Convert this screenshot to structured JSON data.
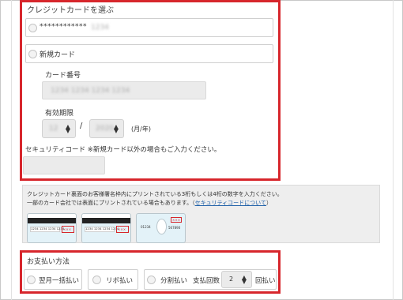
{
  "card_select": {
    "title": "クレジットカードを選ぶ",
    "saved_card_mask": "************",
    "saved_card_suffix": "1234",
    "new_card_label": "新規カード",
    "card_number_label": "カード番号",
    "card_number_value": "1234 1234 1234 1234",
    "expiry_label": "有効期限",
    "expiry_month": "12",
    "expiry_separator": "/",
    "expiry_year": "2020",
    "expiry_unit": "(月/年)",
    "security_label": "セキュリティコード ※新規カード以外の場合もご入力ください。"
  },
  "info": {
    "line1": "クレジットカード裏面のお客様署名枠内にプリントされている3桁もしくは4桁の数字を入力ください。",
    "line2_prefix": "一部のカード会社では表面にプリントされている場合もあります。（",
    "line2_link": "セキュリティコードについて",
    "line2_suffix": "）",
    "card_numbers": [
      "1234 1234 1234 1234",
      "1234 1234 1234 1234",
      "01234"
    ],
    "card_code": "567890"
  },
  "payment": {
    "title": "お支払い方法",
    "options": [
      "翌月一括払い",
      "リボ払い",
      "分割払い"
    ],
    "installments_label": "支払回数",
    "installments_value": "2",
    "installments_unit": "回払い"
  }
}
